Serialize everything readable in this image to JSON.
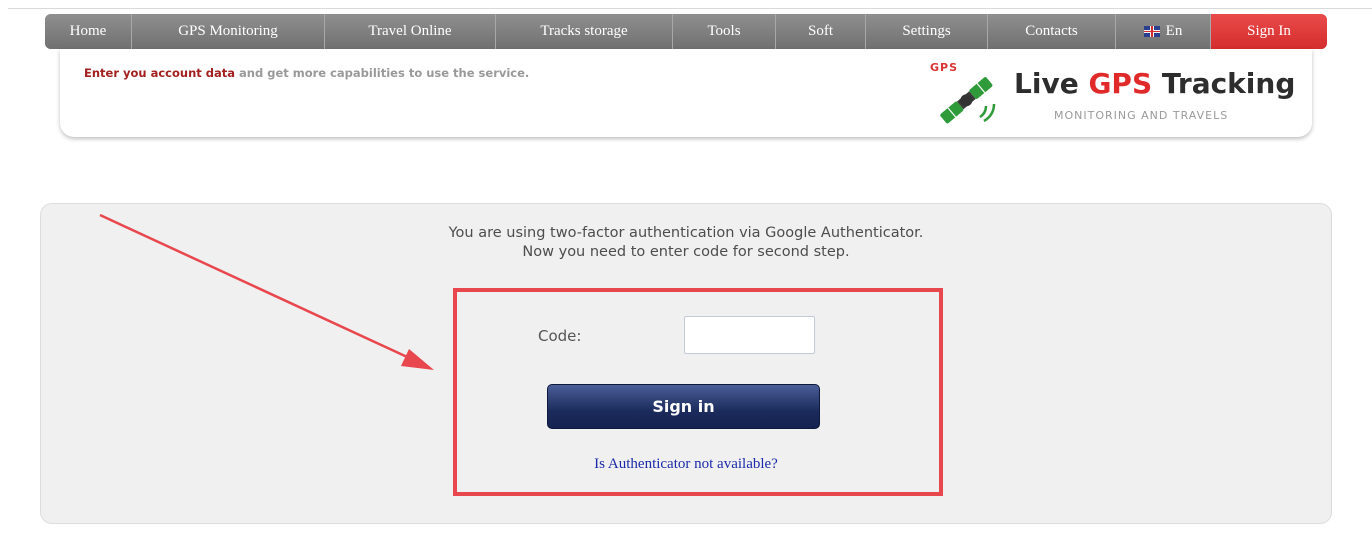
{
  "nav": {
    "items": [
      {
        "label": "Home"
      },
      {
        "label": "GPS Monitoring"
      },
      {
        "label": "Travel Online"
      },
      {
        "label": "Tracks storage"
      },
      {
        "label": "Tools"
      },
      {
        "label": "Soft"
      },
      {
        "label": "Settings"
      },
      {
        "label": "Contacts"
      },
      {
        "label": "En"
      },
      {
        "label": "Sign In"
      }
    ],
    "language_icon": "uk-flag-icon"
  },
  "header": {
    "account_msg_highlight": "Enter you account data",
    "account_msg_rest": " and get more capabilities to use the service.",
    "logo": {
      "badge": "GPS",
      "title_part1": "Live ",
      "title_part2": "GPS",
      "title_part3": " Tracking",
      "subtitle": "MONITORING AND TRAVELS",
      "icon": "satellite-icon"
    }
  },
  "auth": {
    "line1": "You are using two-factor authentication via Google Authenticator.",
    "line2": "Now you need to enter code for second step.",
    "code_label": "Code:",
    "code_value": "",
    "signin_label": "Sign in",
    "alt_link": "Is Authenticator not available?"
  },
  "colors": {
    "nav_gray": "#7d7d7d",
    "nav_active": "#d93434",
    "annotation_red": "#e8474d",
    "button_navy": "#1b2b5c",
    "link_blue": "#1b2aa8"
  }
}
